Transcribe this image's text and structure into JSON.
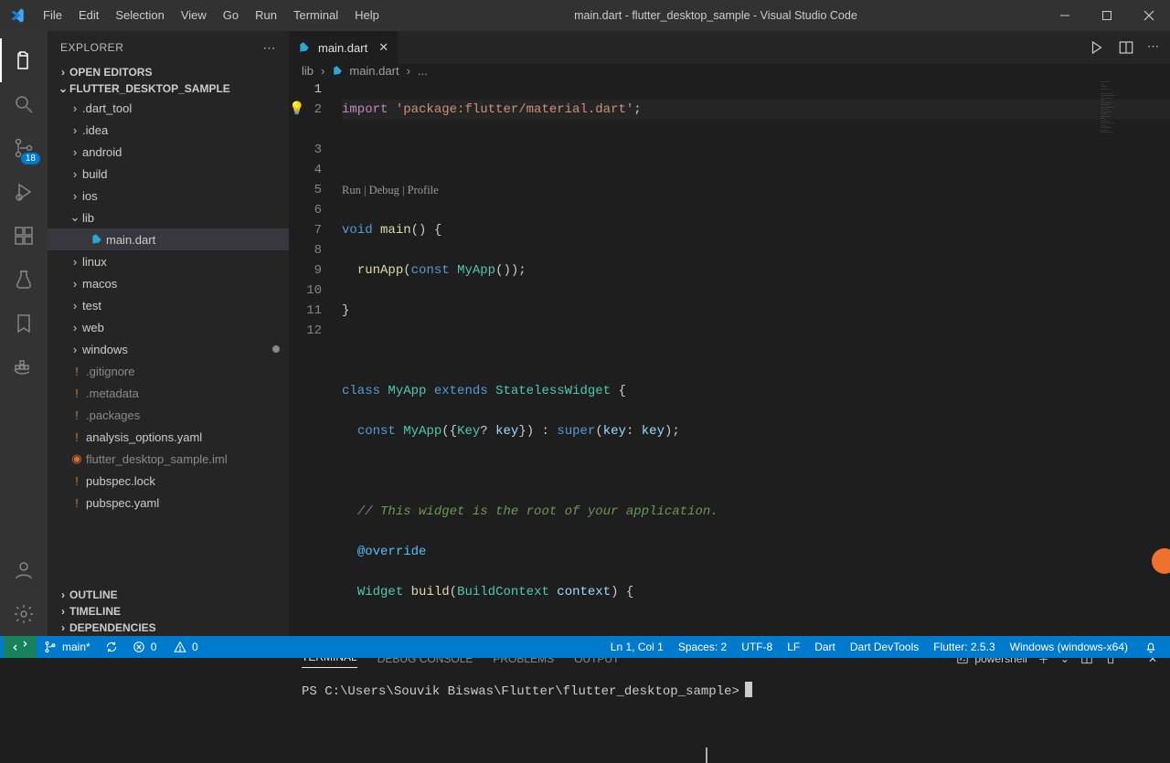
{
  "title": "main.dart - flutter_desktop_sample - Visual Studio Code",
  "menu": [
    "File",
    "Edit",
    "Selection",
    "View",
    "Go",
    "Run",
    "Terminal",
    "Help"
  ],
  "activityBadge": "18",
  "sidebarHeader": "EXPLORER",
  "sections": {
    "openEditors": "OPEN EDITORS",
    "project": "FLUTTER_DESKTOP_SAMPLE",
    "outline": "OUTLINE",
    "timeline": "TIMELINE",
    "dependencies": "DEPENDENCIES"
  },
  "tree": {
    "folders": [
      ".dart_tool",
      ".idea",
      "android",
      "build",
      "ios",
      "lib",
      "linux",
      "macos",
      "test",
      "web",
      "windows"
    ],
    "libFile": "main.dart",
    "files": [
      ".gitignore",
      ".metadata",
      ".packages",
      "analysis_options.yaml",
      "flutter_desktop_sample.iml",
      "pubspec.lock",
      "pubspec.yaml"
    ]
  },
  "tab": {
    "label": "main.dart"
  },
  "breadcrumb": {
    "folder": "lib",
    "file": "main.dart",
    "more": "..."
  },
  "codelens": "Run | Debug | Profile",
  "code": {
    "l1": "import 'package:flutter/material.dart';",
    "l3": "void main() {",
    "l4": "  runApp(const MyApp());",
    "l5": "}",
    "l7": "class MyApp extends StatelessWidget {",
    "l8": "  const MyApp({Key? key}) : super(key: key);",
    "l10": "  // This widget is the root of your application.",
    "l11": "  @override",
    "l12": "  Widget build(BuildContext context) {"
  },
  "lineNumbers": [
    "1",
    "2",
    "",
    "3",
    "4",
    "5",
    "6",
    "7",
    "8",
    "9",
    "10",
    "11",
    "12"
  ],
  "panelTabs": [
    "TERMINAL",
    "DEBUG CONSOLE",
    "PROBLEMS",
    "OUTPUT"
  ],
  "shell": "powershell",
  "prompt": "PS C:\\Users\\Souvik Biswas\\Flutter\\flutter_desktop_sample>",
  "status": {
    "branch": "main*",
    "sync": "",
    "errors": "0",
    "warnings": "0",
    "cursor": "Ln 1, Col 1",
    "spaces": "Spaces: 2",
    "encoding": "UTF-8",
    "eol": "LF",
    "lang": "Dart",
    "devtools": "Dart DevTools",
    "flutter": "Flutter: 2.5.3",
    "device": "Windows (windows-x64)"
  }
}
